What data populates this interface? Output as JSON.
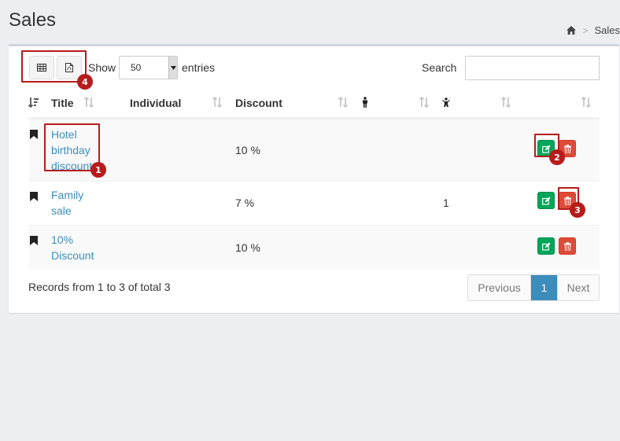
{
  "page": {
    "title": "Sales"
  },
  "breadcrumb": {
    "separator": ">",
    "current": "Sales"
  },
  "toolbar": {
    "show_label": "Show",
    "page_size": "50",
    "entries_label": "entries",
    "search_label": "Search",
    "search_value": ""
  },
  "table": {
    "columns": [
      "Title",
      "Individual",
      "Discount"
    ],
    "rows": [
      {
        "title_lines": [
          "Hotel",
          "birthday",
          "discount"
        ],
        "individual": "",
        "discount": "10 %",
        "count": ""
      },
      {
        "title_lines": [
          "Family",
          "sale"
        ],
        "individual": "",
        "discount": "7 %",
        "count": "1"
      },
      {
        "title_lines": [
          "10%",
          "Discount"
        ],
        "individual": "",
        "discount": "10 %",
        "count": ""
      }
    ]
  },
  "footer": {
    "info": "Records from 1 to 3 of total 3",
    "previous": "Previous",
    "current_page": "1",
    "next": "Next"
  },
  "annotations": [
    "1",
    "2",
    "3",
    "4"
  ],
  "colors": {
    "primary": "#3c8dbc",
    "success": "#00a65a",
    "danger": "#dd4b39",
    "annotation": "#b71c1c"
  }
}
